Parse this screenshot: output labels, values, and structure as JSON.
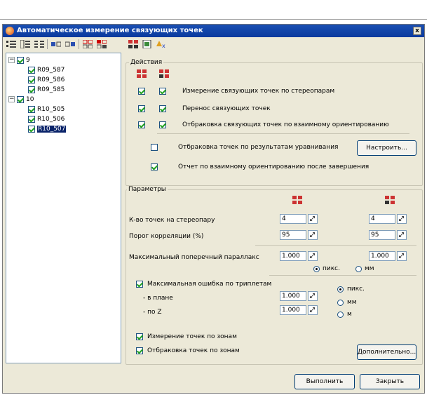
{
  "window": {
    "title": "Автоматическое измерение связующих точек",
    "close": "x"
  },
  "tree": {
    "groups": [
      {
        "label": "9",
        "items": [
          "R09_587",
          "R09_586",
          "R09_585"
        ]
      },
      {
        "label": "10",
        "items": [
          "R10_505",
          "R10_506",
          "R10_507"
        ]
      }
    ],
    "selected": "R10_507"
  },
  "actions": {
    "legend": "Действия",
    "items": [
      "Измерение связующих точек по стереопарам",
      "Перенос связующих точек",
      "Отбраковка связующих точек по взаимному ориентированию"
    ],
    "reject_by_adjustment": "Отбраковка точек по результатам уравнивания",
    "configure_button": "Настроить...",
    "report": "Отчет по взаимному ориентированию после завершения"
  },
  "params": {
    "legend": "Параметры",
    "points_per_pair": {
      "label": "К-во точек на стереопару",
      "left": "4",
      "right": "4"
    },
    "corr_threshold": {
      "label": "Порог корреляции (%)",
      "left": "95",
      "right": "95"
    },
    "max_parallax": {
      "label": "Максимальный поперечный параллакс",
      "left": "1.000",
      "right": "1.000"
    },
    "units": {
      "pix": "пикс.",
      "mm": "мм",
      "selected": "пикс."
    },
    "triplet": {
      "label": "Максимальная ошибка по триплетам",
      "plan_label": "- в плане",
      "plan_value": "1.000",
      "z_label": "- по Z",
      "z_value": "1.000",
      "unit_options": [
        "пикс.",
        "мм",
        "м"
      ],
      "selected": "пикс."
    },
    "zone_measure": "Измерение точек по зонам",
    "zone_reject": "Отбраковка точек по зонам",
    "more_button": "Дополнительно..."
  },
  "footer": {
    "run": "Выполнить",
    "close": "Закрыть"
  }
}
